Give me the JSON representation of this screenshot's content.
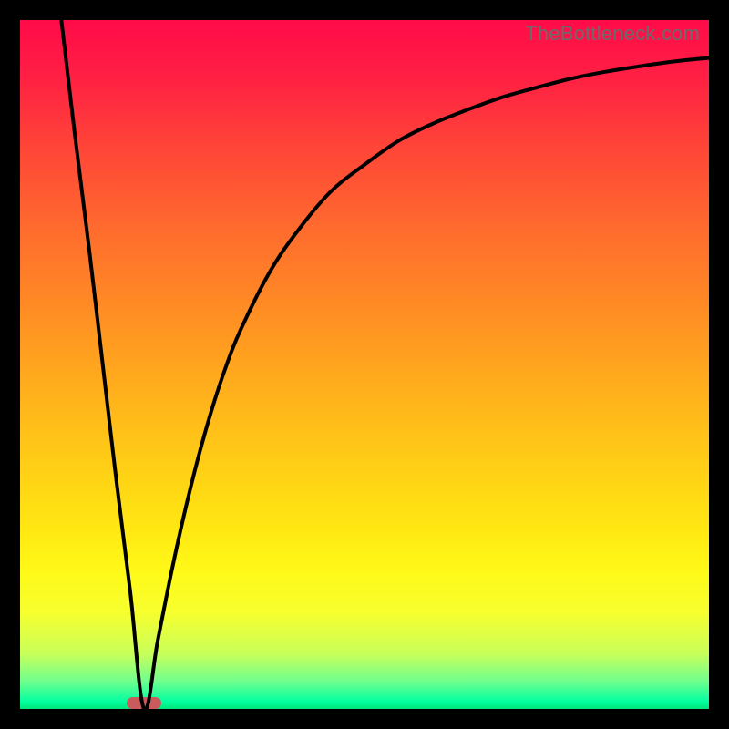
{
  "watermark": "TheBottleneck.com",
  "colors": {
    "frame": "#000000",
    "gradient_top": "#ff0b48",
    "gradient_bottom": "#00e47a",
    "curve": "#000000",
    "marker": "#ca5b5d",
    "watermark_text": "#6b6b6b"
  },
  "chart_data": {
    "type": "line",
    "title": "",
    "xlabel": "",
    "ylabel": "",
    "xlim": [
      0,
      100
    ],
    "ylim": [
      0,
      100
    ],
    "grid": false,
    "legend": false,
    "annotations": [
      "TheBottleneck.com"
    ],
    "description": "V-shaped bottleneck curve. The background color (green at bottom to red at top) encodes the y value; the black line trace shows the bottleneck metric versus an x parameter. Minimum (best) value is near x≈18 at y≈0 marked by a pill; curve rises to y≈100 at both ends.",
    "min_marker_x": 18,
    "series": [
      {
        "name": "bottleneck-curve",
        "x": [
          6,
          8,
          10,
          12,
          14,
          16,
          18,
          20,
          22,
          24,
          26,
          28,
          30,
          32,
          36,
          40,
          45,
          50,
          55,
          60,
          65,
          70,
          75,
          80,
          85,
          90,
          95,
          100
        ],
        "y": [
          100,
          83,
          67,
          50,
          33,
          17,
          0,
          10,
          20,
          29,
          37,
          44,
          50,
          55,
          63,
          69,
          75,
          79,
          82.5,
          85,
          87,
          88.8,
          90.2,
          91.5,
          92.5,
          93.3,
          94,
          94.5
        ]
      }
    ]
  }
}
